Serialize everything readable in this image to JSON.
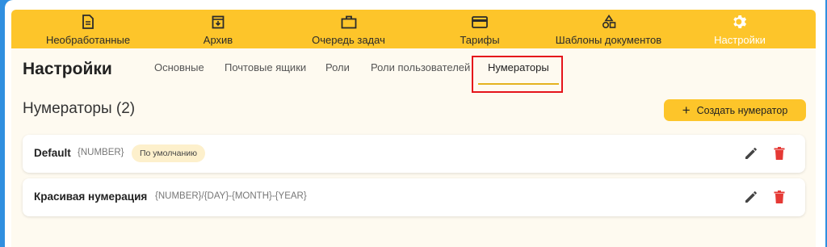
{
  "nav": {
    "items": [
      {
        "label": "Необработанные",
        "icon": "document-icon"
      },
      {
        "label": "Архив",
        "icon": "archive-icon"
      },
      {
        "label": "Очередь задач",
        "icon": "briefcase-icon"
      },
      {
        "label": "Тарифы",
        "icon": "credit-card-icon"
      },
      {
        "label": "Шаблоны документов",
        "icon": "shapes-icon"
      },
      {
        "label": "Настройки",
        "icon": "gear-icon"
      }
    ],
    "active": "Настройки"
  },
  "page": {
    "title": "Настройки",
    "tabs": [
      {
        "label": "Основные"
      },
      {
        "label": "Почтовые ящики"
      },
      {
        "label": "Роли"
      },
      {
        "label": "Роли пользователей"
      },
      {
        "label": "Нумераторы"
      }
    ],
    "active_tab": "Нумераторы"
  },
  "numerators": {
    "title": "Нумераторы (2)",
    "create_label": "Создать нумератор",
    "items": [
      {
        "name": "Default",
        "pattern": "{NUMBER}",
        "badge": "По умолчанию"
      },
      {
        "name": "Красивая нумерация",
        "pattern": "{NUMBER}/{DAY}-{MONTH}-{YEAR}",
        "badge": ""
      }
    ]
  },
  "colors": {
    "accent": "#fdc52a",
    "delete": "#e53935",
    "highlight": "#e5141b"
  }
}
